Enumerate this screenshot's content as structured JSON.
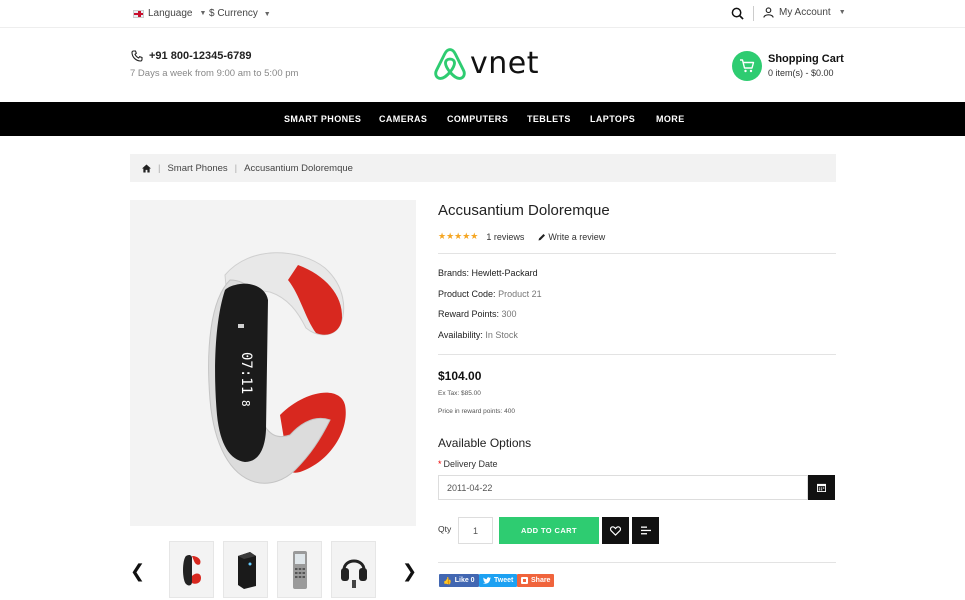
{
  "topbar": {
    "language_label": "Language",
    "currency_label": "$ Currency",
    "account_label": "My Account"
  },
  "header": {
    "phone": "+91 800-12345-6789",
    "hours": "7 Days a week from 9:00 am to 5:00 pm",
    "logo_text": "vnet",
    "cart_title": "Shopping Cart",
    "cart_count": "0 item(s) - $0.00",
    "accent_color": "#2ecc71"
  },
  "nav": {
    "items": [
      "SMART PHONES",
      "CAMERAS",
      "COMPUTERS",
      "TEBLETS",
      "LAPTOPS",
      "MORE"
    ]
  },
  "breadcrumb": {
    "items": [
      "Smart Phones",
      "Accusantium Doloremque"
    ]
  },
  "product": {
    "title": "Accusantium Doloremque",
    "rating": 5,
    "reviews": "1 reviews",
    "write_review": "Write a review",
    "brand_label": "Brands:",
    "brand_value": "Hewlett-Packard",
    "code_label": "Product Code:",
    "code_value": "Product 21",
    "reward_label": "Reward Points:",
    "reward_value": "300",
    "availability_label": "Availability:",
    "availability_value": "In Stock",
    "price": "$104.00",
    "ex_tax": "Ex Tax: $85.00",
    "reward_price": "Price in reward points: 400",
    "options_title": "Available Options",
    "delivery_label": "Delivery Date",
    "delivery_value": "2011-04-22",
    "qty_label": "Qty",
    "qty_value": "1",
    "add_to_cart": "ADD TO CART"
  },
  "thumbnails": [
    "smartband",
    "desktop-tower",
    "phone",
    "headphones"
  ],
  "social": {
    "like": "Like 0",
    "tweet": "Tweet",
    "share": "Share",
    "like_color": "#4267b2",
    "tweet_color": "#1da1f2",
    "share_color": "#f0643c"
  }
}
